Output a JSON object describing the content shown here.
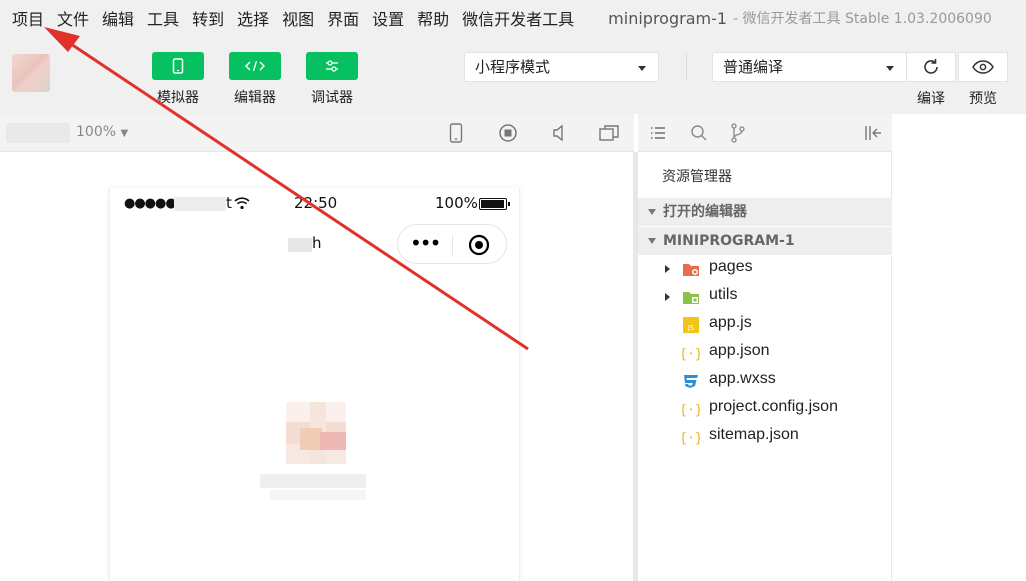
{
  "menu": [
    "项目",
    "文件",
    "编辑",
    "工具",
    "转到",
    "选择",
    "视图",
    "界面",
    "设置",
    "帮助",
    "微信开发者工具"
  ],
  "window": {
    "title": "miniprogram-1",
    "subtitle": "- 微信开发者工具 Stable 1.03.2006090"
  },
  "toolbar": {
    "simulator_label": "模拟器",
    "editor_label": "编辑器",
    "debugger_label": "调试器",
    "mode_select": "小程序模式",
    "compile_select": "普通编译",
    "compile_label": "编译",
    "preview_label": "预览"
  },
  "simulator": {
    "zoom": "100%",
    "status_time": "22:50",
    "battery_pct": "100%",
    "carrier_tail": "t",
    "nav_title_tail": "h"
  },
  "explorer": {
    "title": "资源管理器",
    "open_editors": "打开的编辑器",
    "project": "MINIPROGRAM-1",
    "items": [
      {
        "name": "pages",
        "type": "folder",
        "icon": "folder-pages-icon",
        "color": "#e86c4a"
      },
      {
        "name": "utils",
        "type": "folder",
        "icon": "folder-utils-icon",
        "color": "#8bc34a"
      },
      {
        "name": "app.js",
        "type": "file",
        "icon": "js-file-icon",
        "color": "#f0c419"
      },
      {
        "name": "app.json",
        "type": "file",
        "icon": "json-file-icon",
        "color": "#e6b422"
      },
      {
        "name": "app.wxss",
        "type": "file",
        "icon": "css-file-icon",
        "color": "#2d8fd5"
      },
      {
        "name": "project.config.json",
        "type": "file",
        "icon": "json-file-icon",
        "color": "#e6b422"
      },
      {
        "name": "sitemap.json",
        "type": "file",
        "icon": "json-file-icon",
        "color": "#e6b422"
      }
    ]
  },
  "colors": {
    "accent_green": "#07c160",
    "annotation_red": "#e0322b"
  }
}
